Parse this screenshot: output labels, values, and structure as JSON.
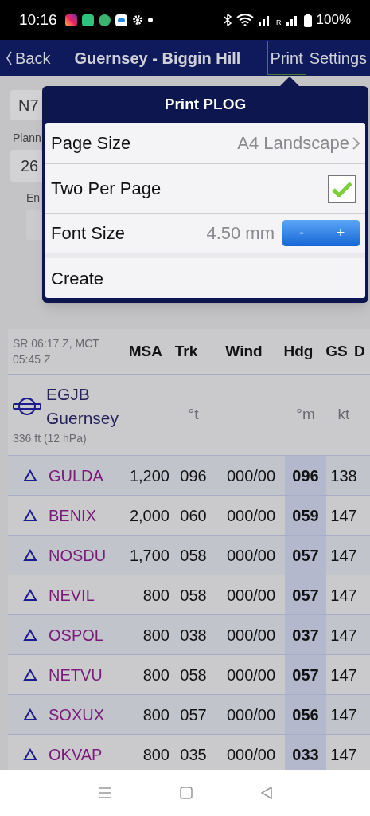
{
  "status_bar": {
    "time": "10:16",
    "battery": "100%",
    "roaming": "R"
  },
  "nav": {
    "back": "Back",
    "title": "Guernsey - Biggin Hill",
    "actions": [
      {
        "label": "Print",
        "selected": true
      },
      {
        "label": "Settings",
        "selected": false
      }
    ]
  },
  "form_behind": {
    "registration": "N7",
    "planned_label": "Plann",
    "planned_value": "26",
    "en_label": "En"
  },
  "popover": {
    "title": "Print PLOG",
    "rows": [
      {
        "kind": "disclosure",
        "label": "Page Size",
        "value": "A4 Landscape"
      },
      {
        "kind": "checkbox",
        "label": "Two Per Page",
        "checked": true
      },
      {
        "kind": "stepper",
        "label": "Font Size",
        "value": "4.50 mm",
        "minus": "-",
        "plus": "+"
      },
      {
        "kind": "action",
        "label": "Create"
      }
    ]
  },
  "table": {
    "sun_info": "SR 06:17 Z, MCT 05:45 Z",
    "columns": [
      "MSA",
      "Trk",
      "Wind",
      "Hdg",
      "GS",
      "D"
    ],
    "origin": {
      "code": "EGJB",
      "name": "Guernsey",
      "elevation": "336 ft (12 hPa)",
      "trk_unit": "°t",
      "hdg_unit": "°m",
      "gs_unit": "kt"
    },
    "rows": [
      {
        "name": "GULDA",
        "msa": "1,200",
        "trk": "096",
        "wind": "000/00",
        "hdg": "096",
        "gs": "138"
      },
      {
        "name": "BENIX",
        "msa": "2,000",
        "trk": "060",
        "wind": "000/00",
        "hdg": "059",
        "gs": "147"
      },
      {
        "name": "NOSDU",
        "msa": "1,700",
        "trk": "058",
        "wind": "000/00",
        "hdg": "057",
        "gs": "147"
      },
      {
        "name": "NEVIL",
        "msa": "800",
        "trk": "058",
        "wind": "000/00",
        "hdg": "057",
        "gs": "147"
      },
      {
        "name": "OSPOL",
        "msa": "800",
        "trk": "038",
        "wind": "000/00",
        "hdg": "037",
        "gs": "147"
      },
      {
        "name": "NETVU",
        "msa": "800",
        "trk": "058",
        "wind": "000/00",
        "hdg": "057",
        "gs": "147"
      },
      {
        "name": "SOXUX",
        "msa": "800",
        "trk": "057",
        "wind": "000/00",
        "hdg": "056",
        "gs": "147"
      },
      {
        "name": "OKVAP",
        "msa": "800",
        "trk": "035",
        "wind": "000/00",
        "hdg": "033",
        "gs": "147"
      }
    ]
  }
}
